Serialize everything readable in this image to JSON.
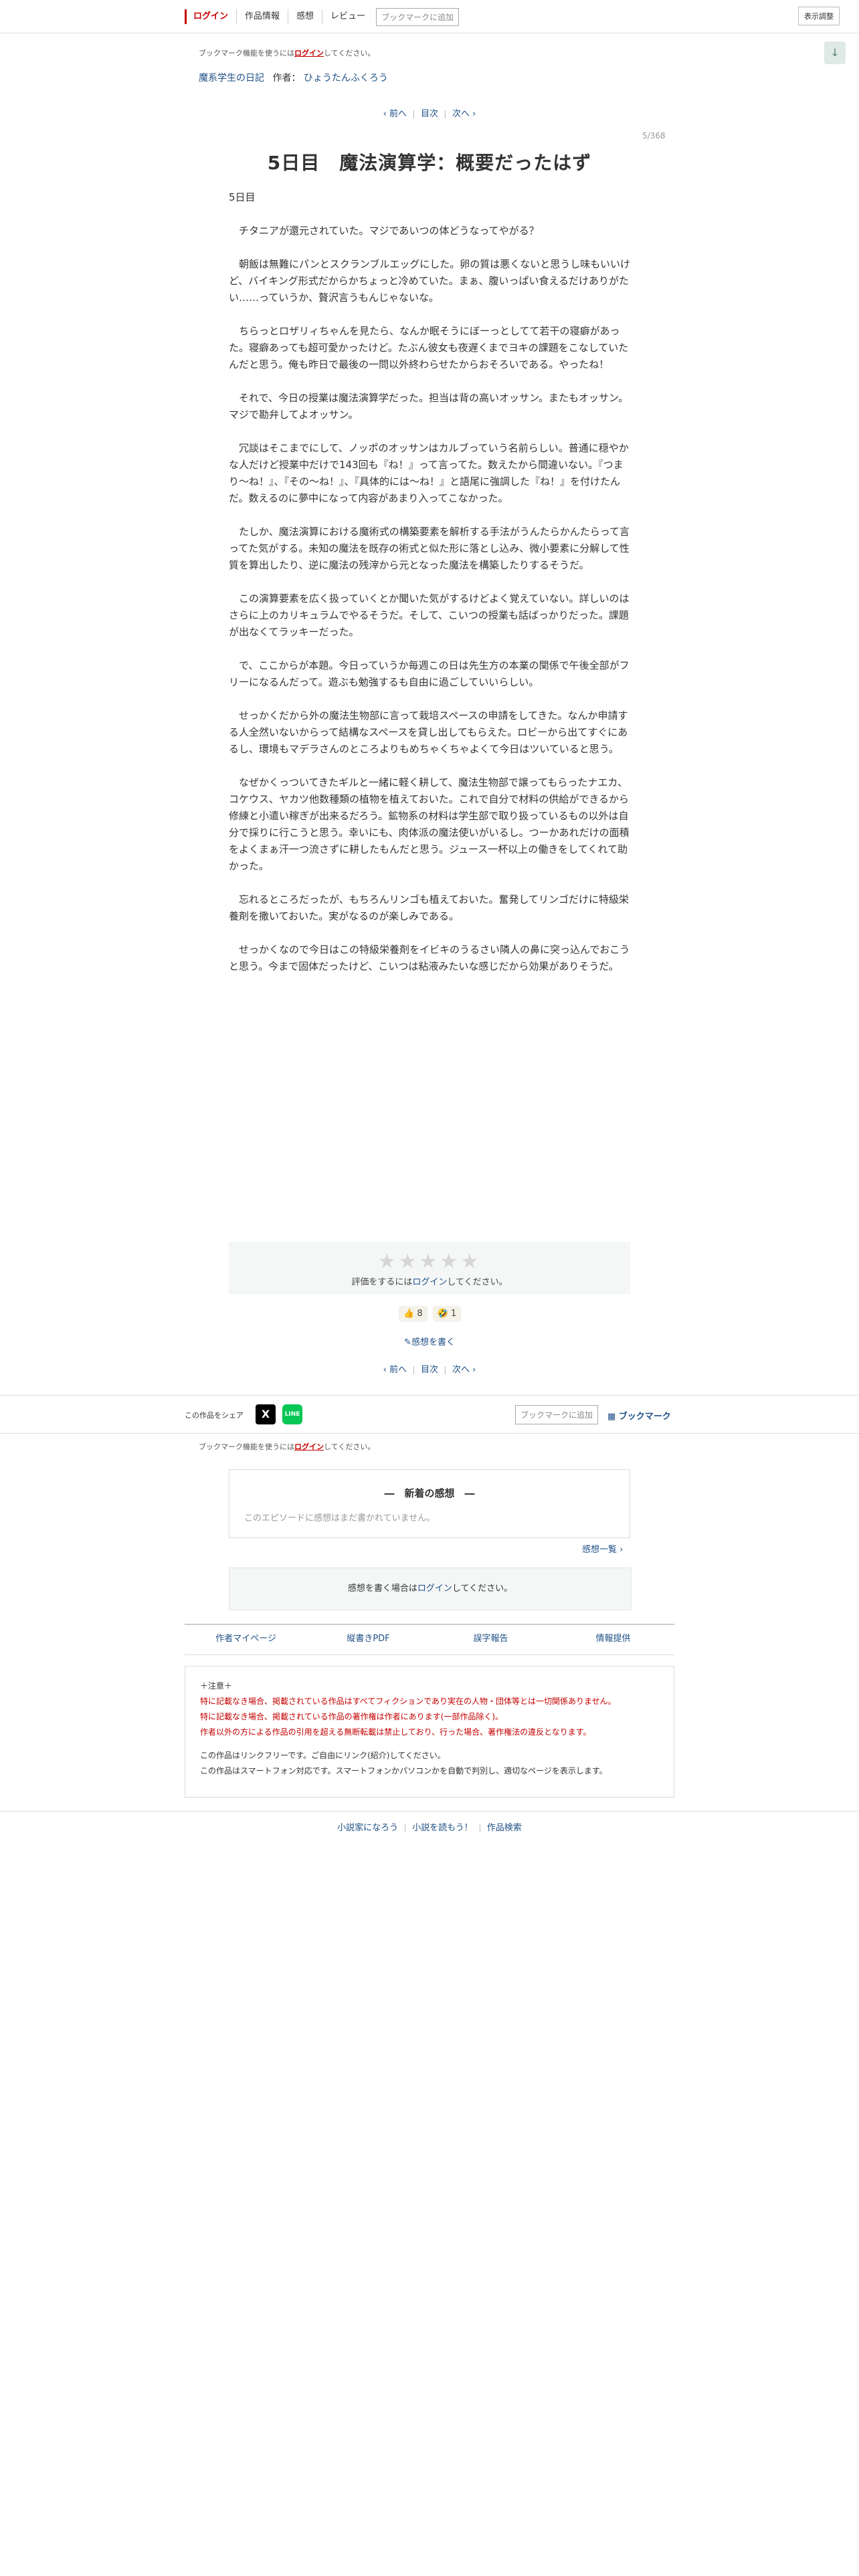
{
  "header": {
    "login": "ログイン",
    "nav": [
      "作品情報",
      "感想",
      "レビュー"
    ],
    "bookmark_add": "ブックマークに追加",
    "display_settings": "表示調整",
    "scroll_icon": "↓"
  },
  "bookmark_note": {
    "prefix": "ブックマーク機能を使うには",
    "link": "ログイン",
    "suffix": "してください。"
  },
  "series": {
    "title": "魔系学生の日記",
    "author_label": "作者：",
    "author": "ひょうたんふくろう"
  },
  "pager": {
    "prev": "‹ 前へ",
    "toc": "目次",
    "next": "次へ ›"
  },
  "page_no": "5/368",
  "episode": {
    "title": "5日目　魔法演算学：概要だったはず",
    "subtitle": "5日目",
    "paragraphs": [
      "　チタニアが還元されていた。マジであいつの体どうなってやがる？",
      "　朝飯は無難にパンとスクランブルエッグにした。卵の質は悪くないと思うし味もいいけど、バイキング形式だからかちょっと冷めていた。まぁ、腹いっぱい食えるだけありがたい……っていうか、贅沢言うもんじゃないな。",
      "　ちらっとロザリィちゃんを見たら、なんか眠そうにぼーっとしてて若干の寝癖があった。寝癖あっても超可愛かったけど。たぶん彼女も夜遅くまでヨキの課題をこなしていたんだと思う。俺も昨日で最後の一問以外終わらせたからおそろいである。やったね！",
      "　それで、今日の授業は魔法演算学だった。担当は背の高いオッサン。またもオッサン。マジで勘弁してよオッサン。",
      "　冗談はそこまでにして、ノッポのオッサンはカルブっていう名前らしい。普通に穏やかな人だけど授業中だけで143回も『ね！』って言ってた。数えたから間違いない。『つまり〜ね！』、『その〜ね！』、『具体的には〜ね！』と語尾に強調した『ね！』を付けたんだ。数えるのに夢中になって内容があまり入ってこなかった。",
      "　たしか、魔法演算における魔術式の構築要素を解析する手法がうんたらかんたらって言ってた気がする。未知の魔法を既存の術式と似た形に落とし込み、微小要素に分解して性質を算出したり、逆に魔法の残滓から元となった魔法を構築したりするそうだ。",
      "　この演算要素を広く扱っていくとか聞いた気がするけどよく覚えていない。詳しいのはさらに上のカリキュラムでやるそうだ。そして、こいつの授業も話ばっかりだった。課題が出なくてラッキーだった。",
      "　で、ここからが本題。今日っていうか毎週この日は先生方の本業の関係で午後全部がフリーになるんだって。遊ぶも勉強するも自由に過ごしていいらしい。",
      "　せっかくだから外の魔法生物部に言って栽培スペースの申請をしてきた。なんか申請する人全然いないからって結構なスペースを貸し出してもらえた。ロビーから出てすぐにあるし、環境もマデラさんのところよりもめちゃくちゃよくて今日はツいていると思う。",
      "　なぜかくっついてきたギルと一緒に軽く耕して、魔法生物部で譲ってもらったナエカ、コケウス、ヤカツ他数種類の植物を植えておいた。これで自分で材料の供給ができるから修練と小遣い稼ぎが出来るだろう。鉱物系の材料は学生部で取り扱っているもの以外は自分で採りに行こうと思う。幸いにも、肉体派の魔法使いがいるし。つーかあれだけの面積をよくまぁ汗一つ流さずに耕したもんだと思う。ジュース一杯以上の働きをしてくれて助かった。",
      "　忘れるところだったが、もちろんリンゴも植えておいた。奮発してリンゴだけに特級栄養剤を撒いておいた。実がなるのが楽しみである。",
      "　せっかくなので今日はこの特級栄養剤をイビキのうるさい隣人の鼻に突っ込んでおこうと思う。今まで固体だったけど、こいつは粘液みたいな感じだから効果がありそうだ。"
    ]
  },
  "rating": {
    "stars": "★★★★★",
    "prefix": "評価をするには",
    "link": "ログイン",
    "suffix": "してください。"
  },
  "reactions": [
    {
      "icon": "👍",
      "count": "8"
    },
    {
      "icon": "🤣",
      "count": "1"
    }
  ],
  "write_kansou_link": "✎感想を書く",
  "share": {
    "label": "この作品をシェア",
    "x_icon": "X",
    "line_icon": "LINE",
    "bookmark_add": "ブックマークに追加",
    "bookmark": "▦ ブックマーク"
  },
  "latest_kansou": {
    "heading": "―　新着の感想　―",
    "empty": "このエピソードに感想はまだ書かれていません。",
    "list_link": "感想一覧 ›"
  },
  "write_prompt": {
    "prefix": "感想を書く場合は",
    "link": "ログイン",
    "suffix": "してください。"
  },
  "footer_links": [
    "作者マイページ",
    "縦書きPDF",
    "誤字報告",
    "情報提供"
  ],
  "notice": {
    "title": "＋注意＋",
    "red_lines": [
      "特に記載なき場合、掲載されている作品はすべてフィクションであり実在の人物・団体等とは一切関係ありません。",
      "特に記載なき場合、掲載されている作品の著作権は作者にあります(一部作品除く)。",
      "作者以外の方による作品の引用を超える無断転載は禁止しており、行った場合、著作権法の違反となります。"
    ],
    "gray_lines": [
      "この作品はリンクフリーです。ご自由にリンク(紹介)してください。",
      "この作品はスマートフォン対応です。スマートフォンかパソコンかを自動で判別し、適切なページを表示します。"
    ]
  },
  "bottom_links": [
    "小説家になろう",
    "小説を読もう！",
    "作品検索"
  ]
}
